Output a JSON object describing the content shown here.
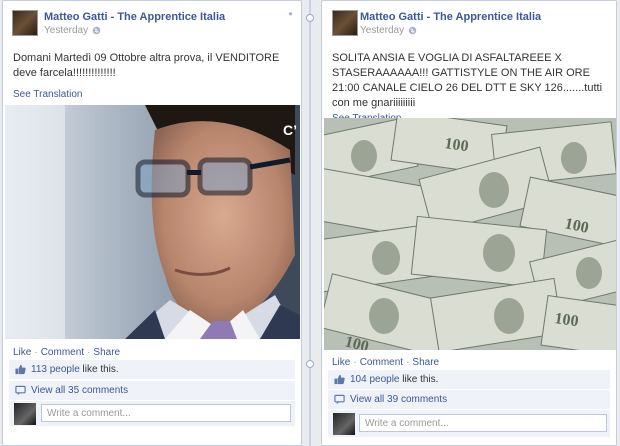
{
  "posts": [
    {
      "author": "Matteo Gatti - The Apprentice Italia",
      "time": "Yesterday",
      "text": "Domani Martedì 09 Ottobre altra prova, il VENDITORE deve farcela!!!!!!!!!!!!!!",
      "see_translation": "See Translation",
      "photo_overlay_text": "C’",
      "actions": {
        "like": "Like",
        "comment": "Comment",
        "share": "Share"
      },
      "likes_count": "113 people",
      "likes_suffix": "like this.",
      "view_comments": "View all 35 comments",
      "comment_placeholder": "Write a comment..."
    },
    {
      "author": "Matteo Gatti - The Apprentice Italia",
      "time": "Yesterday",
      "text": "SOLITA ANSIA E VOGLIA DI ASFALTAREEE X STASERAAAAAA!!! GATTISTYLE ON THE AIR ORE 21:00 CANALE CIELO 26 DEL DTT E SKY 126.......tutti con me gnariiiiiiiii",
      "see_translation": "See Translation",
      "actions": {
        "like": "Like",
        "comment": "Comment",
        "share": "Share"
      },
      "likes_count": "104 people",
      "likes_suffix": "like this.",
      "view_comments": "View all 39 comments",
      "comment_placeholder": "Write a comment..."
    }
  ],
  "colors": {
    "link": "#3b5998",
    "ufi_bg": "#eff2f8",
    "page_bg": "#e9ebee"
  }
}
